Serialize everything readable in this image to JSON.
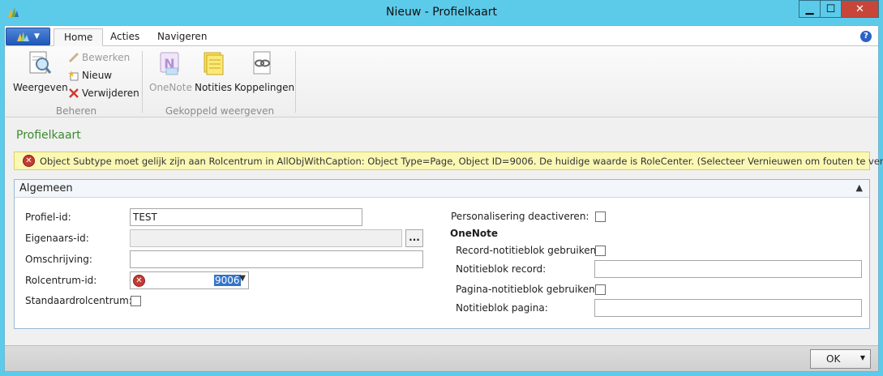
{
  "window": {
    "title": "Nieuw - Profielkaart",
    "minimize": "▁",
    "maximize": "☐",
    "close": "✕"
  },
  "ribbon": {
    "tabs": [
      {
        "label": "Home"
      },
      {
        "label": "Acties"
      },
      {
        "label": "Navigeren"
      }
    ],
    "help": "?",
    "groups": {
      "beheren": {
        "label": "Beheren",
        "weergeven": "Weergeven",
        "bewerken": "Bewerken",
        "nieuw": "Nieuw",
        "verwijderen": "Verwijderen"
      },
      "gekoppeld": {
        "label": "Gekoppeld weergeven",
        "onenote": "OneNote",
        "notities": "Notities",
        "koppelingen": "Koppelingen"
      }
    }
  },
  "page": {
    "title": "Profielkaart",
    "error_icon": "✕",
    "error_message": "Object Subtype moet gelijk zijn aan Rolcentrum in AllObjWithCaption: Object Type=Page, Object ID=9006. De huidige waarde is RoleCenter. (Selecteer Vernieuwen om fouten te verwijderen)"
  },
  "fasttab": {
    "title": "Algemeen",
    "collapse": "▲",
    "left": {
      "profiel_id_label": "Profiel-id:",
      "profiel_id_value": "TEST",
      "eigenaars_id_label": "Eigenaars-id:",
      "eigenaars_id_value": "",
      "ellipsis": "...",
      "omschrijving_label": "Omschrijving:",
      "omschrijving_value": "",
      "rolcentrum_label": "Rolcentrum-id:",
      "rolcentrum_value": "9006",
      "standaard_label": "Standaardrolcentrum:"
    },
    "right": {
      "personalisering_label": "Personalisering deactiveren:",
      "onenote_heading": "OneNote",
      "record_notitieblok_label": "Record-notitieblok gebruiken:",
      "notitieblok_record_label": "Notitieblok record:",
      "pagina_notitieblok_label": "Pagina-notitieblok gebruiken:",
      "notitieblok_pagina_label": "Notitieblok pagina:"
    }
  },
  "footer": {
    "ok_label": "OK",
    "ok_drop": "▼"
  },
  "colors": {
    "accent": "#5ccbea",
    "title_green": "#3c8a2e",
    "error_bg": "#fbf8b4",
    "error_red": "#c23b32"
  }
}
